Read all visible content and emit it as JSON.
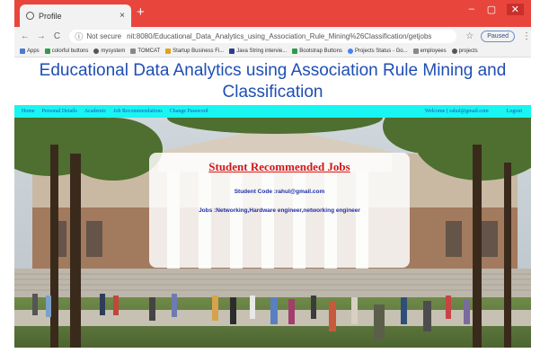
{
  "browser": {
    "tab_title": "Profile",
    "tab_close": "×",
    "new_tab": "+",
    "nav": {
      "back": "←",
      "forward": "→",
      "reload": "C"
    },
    "security_label": "Not secure",
    "url": "nit:8080/Educational_Data_Analytics_using_Association_Rule_Mining%26Classification/getjobs",
    "bookmark_star": "☆",
    "profile_button": "Paused",
    "menu": "⋮",
    "window_controls": {
      "minimize": "–",
      "maximize": "▢",
      "close": "✕"
    }
  },
  "bookmarks": [
    {
      "label": "Apps",
      "color": "#4a7bd0"
    },
    {
      "label": "colorful buttons",
      "color": "#2e9c4a"
    },
    {
      "label": "mysystem",
      "color": "#555555"
    },
    {
      "label": "TOMCAT",
      "color": "#888888"
    },
    {
      "label": "Startup Business Fi...",
      "color": "#e2a21a"
    },
    {
      "label": "Java String intervie...",
      "color": "#2a3d8c"
    },
    {
      "label": "Bootstrap Buttons",
      "color": "#2e9c4a"
    },
    {
      "label": "Projects Status - Go...",
      "color": "#4285f4"
    },
    {
      "label": "employees",
      "color": "#888888"
    },
    {
      "label": "projects",
      "color": "#555555"
    }
  ],
  "page": {
    "title_line1": "Educational Data Analytics using Association Rule Mining and",
    "title_line2": "Classification",
    "menu": {
      "home": "Home",
      "personal": "Personal Details",
      "academic": "Academic",
      "jobs": "Job Recommendations",
      "password": "Change Password",
      "welcome": "Welcome ( rahul@gmail.com",
      "logout": "Logout"
    },
    "card": {
      "heading": "Student Recommended Jobs",
      "student_code": "Student Code :rahul@gmail.com",
      "jobs": "Jobs :Networking,Hardware engineer,networking engineer"
    }
  },
  "colors": {
    "tab_bar": "#e8453c",
    "heading": "#1e4eb4",
    "menu_bar": "#19f5f0",
    "card_heading": "#d21616",
    "card_text": "#1f2fa8"
  }
}
